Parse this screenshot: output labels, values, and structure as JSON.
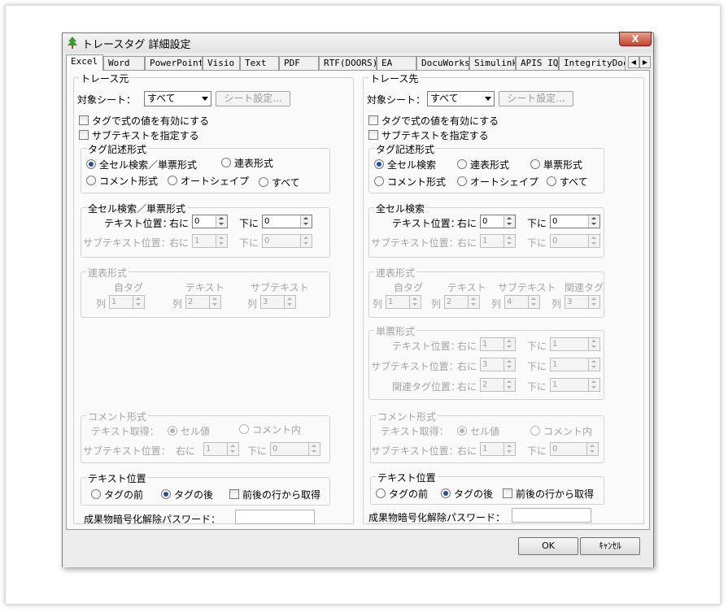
{
  "window": {
    "title": "トレースタグ  詳細設定",
    "close": "X"
  },
  "tabs": [
    "Excel",
    "Word",
    "PowerPoint",
    "Visio",
    "Text",
    "PDF",
    "RTF(DOORS)",
    "EA",
    "DocuWorks",
    "Simulink",
    "APIS IQ",
    "IntegrityDoc"
  ],
  "tab_arrows": {
    "left": "◀",
    "right": "▶"
  },
  "left": {
    "group": "トレース元",
    "sheet_label": "対象シート：",
    "sheet_value": "すべて",
    "sheet_btn": "シート設定...",
    "chk_formula": "タグで式の値を有効にする",
    "chk_subtext": "サブテキストを指定する",
    "format": {
      "legend": "タグ記述形式",
      "r1": "全セル検索／単票形式",
      "r2": "連表形式",
      "r3": "コメント形式",
      "r4": "オートシェイプ",
      "r5": "すべて"
    },
    "cellsearch": {
      "legend": "全セル検索／単票形式",
      "text_pos": "テキスト位置：",
      "right": "右に",
      "down": "下に",
      "v1": "0",
      "v2": "0",
      "sub_pos": "サブテキスト位置：",
      "v3": "1",
      "v4": "0"
    },
    "table": {
      "legend": "連表形式",
      "h1": "自タグ",
      "h2": "テキスト",
      "h3": "サブテキスト",
      "col": "列",
      "v1": "1",
      "v2": "2",
      "v3": "3"
    },
    "comment": {
      "legend": "コメント形式",
      "get": "テキスト取得：",
      "r1": "セル値",
      "r2": "コメント内",
      "sub_pos": "サブテキスト位置：",
      "right": "右に",
      "down": "下に",
      "v1": "1",
      "v2": "0"
    },
    "textpos": {
      "legend": "テキスト位置",
      "r1": "タグの前",
      "r2": "タグの後",
      "chk": "前後の行から取得"
    },
    "password": "成果物暗号化解除パスワード："
  },
  "right": {
    "group": "トレース先",
    "sheet_label": "対象シート：",
    "sheet_value": "すべて",
    "sheet_btn": "シート設定...",
    "chk_formula": "タグで式の値を有効にする",
    "chk_subtext": "サブテキストを指定する",
    "format": {
      "legend": "タグ記述形式",
      "r1": "全セル検索",
      "r2": "連表形式",
      "r3": "単票形式",
      "r4": "コメント形式",
      "r5": "オートシェイプ",
      "r6": "すべて"
    },
    "cellsearch": {
      "legend": "全セル検索",
      "text_pos": "テキスト位置：",
      "right": "右に",
      "down": "下に",
      "v1": "0",
      "v2": "0",
      "sub_pos": "サブテキスト位置：",
      "v3": "1",
      "v4": "0"
    },
    "table": {
      "legend": "連表形式",
      "h1": "自タグ",
      "h2": "テキスト",
      "h3": "サブテキスト",
      "h4": "関連タグ",
      "col": "列",
      "v1": "1",
      "v2": "2",
      "v3": "4",
      "v4": "3"
    },
    "form": {
      "legend": "単票形式",
      "l1": "テキスト位置：",
      "l2": "サブテキスト位置：",
      "l3": "関連タグ位置：",
      "right": "右に",
      "down": "下に",
      "a1": "1",
      "b1": "1",
      "a2": "3",
      "b2": "1",
      "a3": "2",
      "b3": "1"
    },
    "comment": {
      "legend": "コメント形式",
      "get": "テキスト取得：",
      "r1": "セル値",
      "r2": "コメント内",
      "sub_pos": "サブテキスト位置：",
      "right": "右に",
      "down": "下に",
      "v1": "1",
      "v2": "0"
    },
    "textpos": {
      "legend": "テキスト位置",
      "r1": "タグの前",
      "r2": "タグの後",
      "chk": "前後の行から取得"
    },
    "password": "成果物暗号化解除パスワード："
  },
  "buttons": {
    "ok": "OK",
    "cancel": "ｷｬﾝｾﾙ"
  }
}
